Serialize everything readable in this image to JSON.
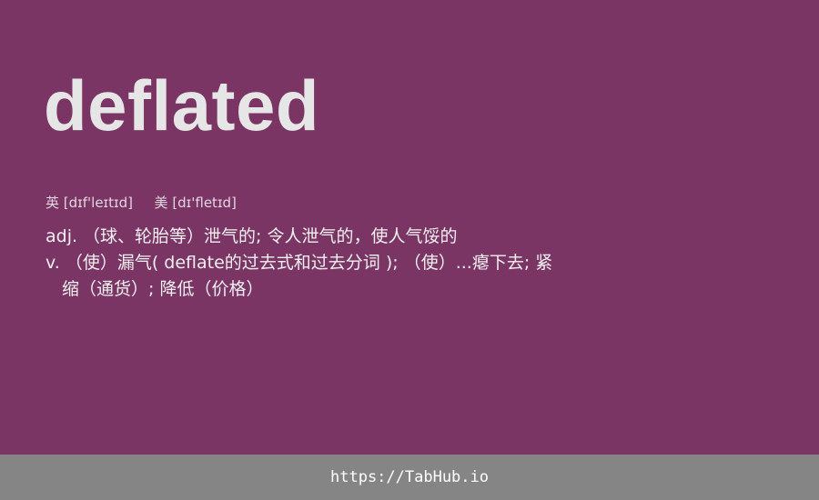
{
  "entry": {
    "word": "deflated",
    "phonetics": {
      "uk_label": "英",
      "uk_ipa": "[dɪf'leɪtɪd]",
      "us_label": "美",
      "us_ipa": "[dɪ'fletɪd]"
    },
    "definitions": {
      "adj": "adj. （球、轮胎等）泄气的; 令人泄气的，使人气馁的",
      "v_line1": "v. （使）漏气( deflate的过去式和过去分词 ); （使）...瘪下去; 紧",
      "v_line2": "缩（通货）; 降低（价格）"
    }
  },
  "footer": {
    "url": "https://TabHub.io"
  }
}
